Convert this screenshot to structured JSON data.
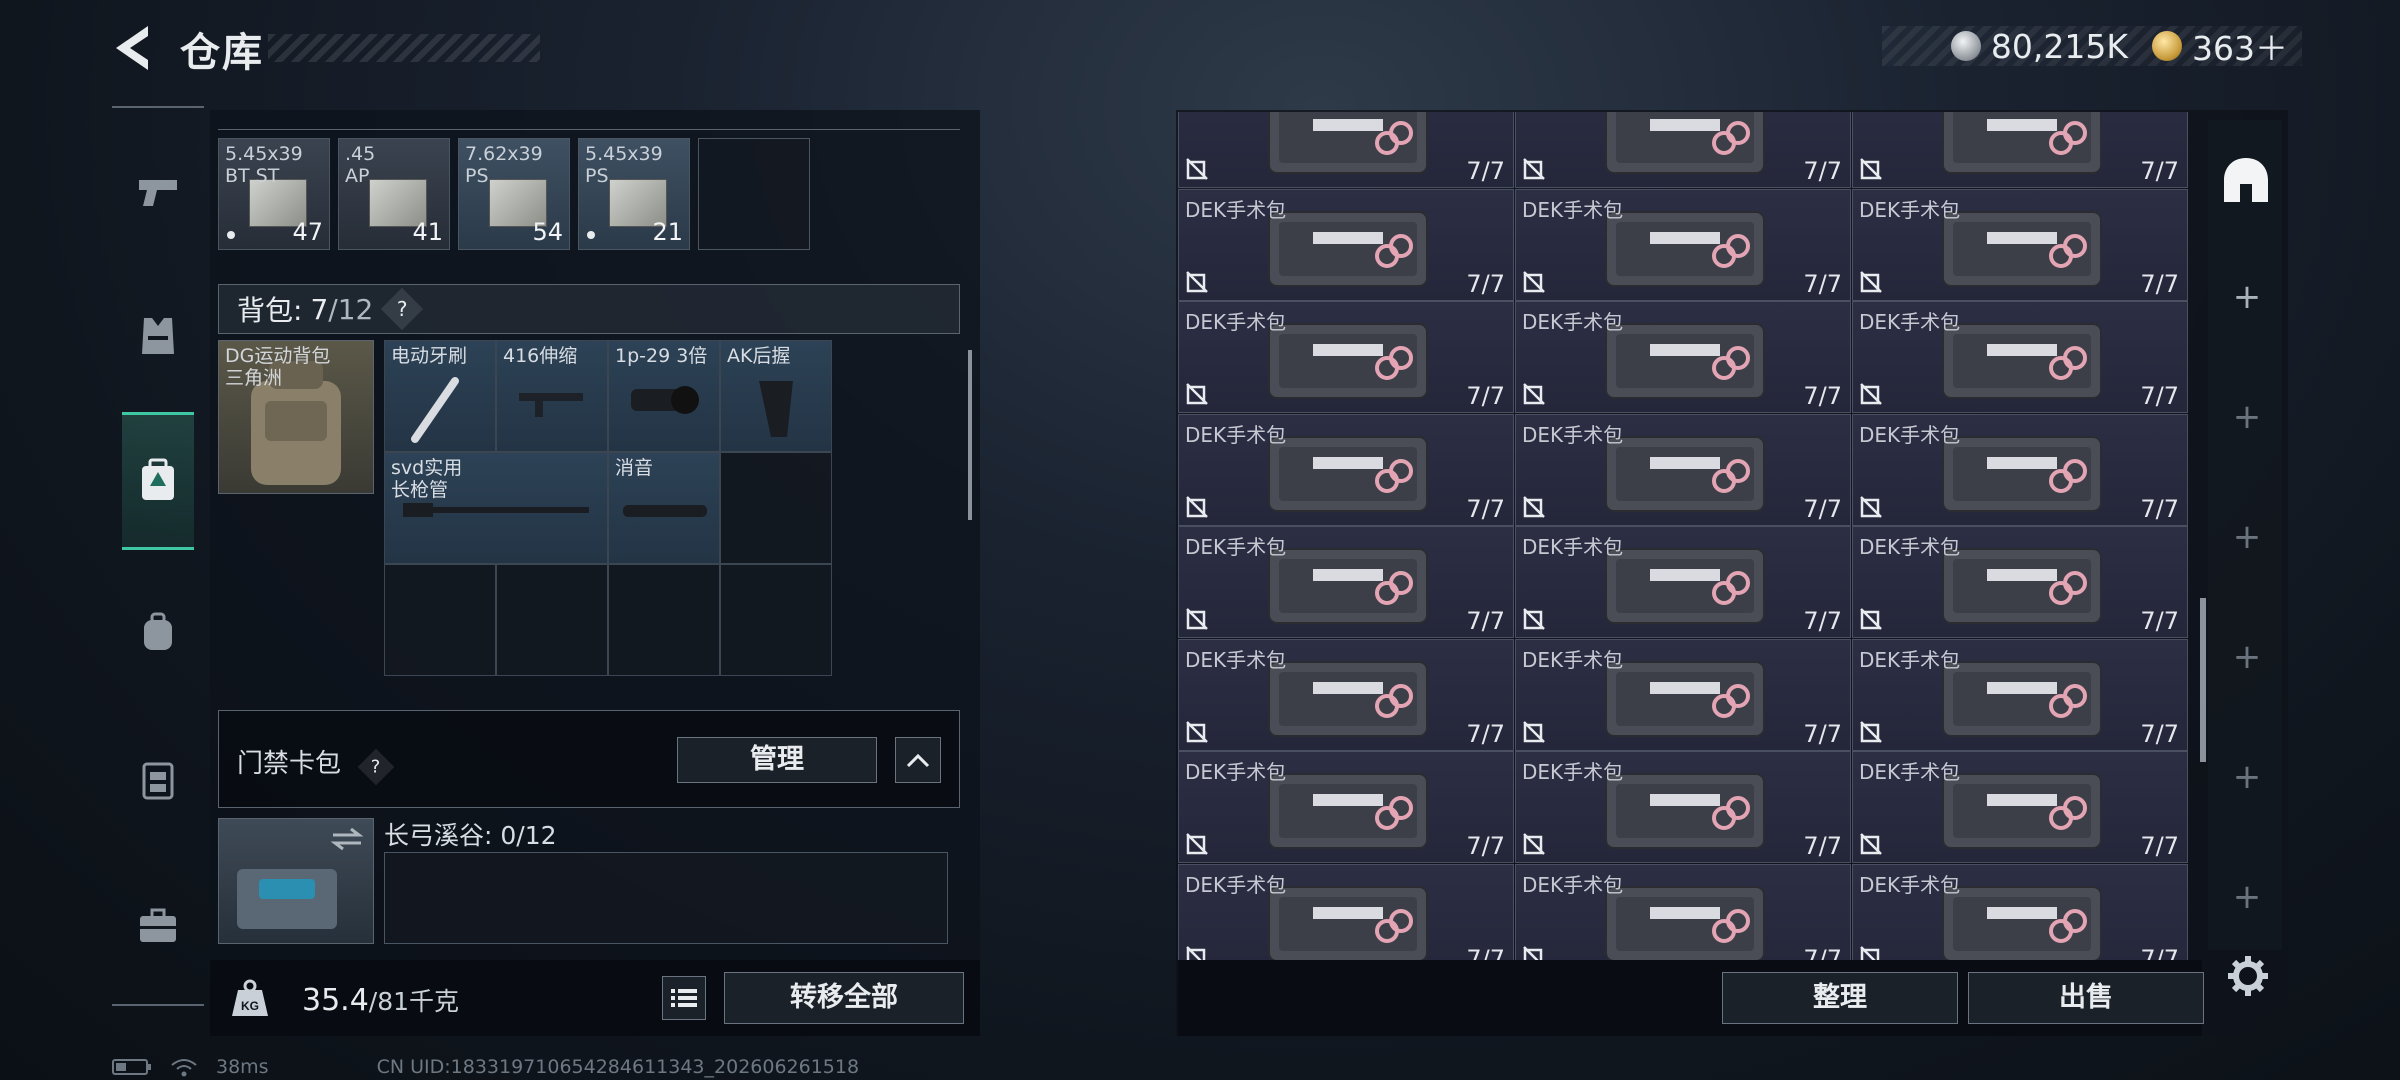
{
  "header": {
    "title": "仓库",
    "currency": [
      {
        "icon": "silver-coin-icon",
        "value": "80,215K"
      },
      {
        "icon": "gold-coin-icon",
        "value": "363＋"
      }
    ]
  },
  "nav": [
    {
      "name": "weapons",
      "icon": "pistol-icon"
    },
    {
      "name": "armor",
      "icon": "vest-icon"
    },
    {
      "name": "storage",
      "icon": "backpack-alert-icon",
      "active": true
    },
    {
      "name": "backpack",
      "icon": "backpack-icon"
    },
    {
      "name": "chest-rig",
      "icon": "rig-icon"
    },
    {
      "name": "case",
      "icon": "briefcase-icon"
    }
  ],
  "ammo": [
    {
      "name": "5.45x39\nBT ST",
      "count": "47",
      "dot": true
    },
    {
      "name": ".45\nAP",
      "count": "41",
      "dot": false
    },
    {
      "name": "7.62x39\nPS",
      "count": "54",
      "dot": false
    },
    {
      "name": "5.45x39\nPS",
      "count": "21",
      "dot": true
    },
    {
      "name": "",
      "count": "",
      "dot": false
    }
  ],
  "backpack": {
    "label": "背包:",
    "count": "7",
    "capacity": "/12",
    "help": "?",
    "bag_name": "DG运动背包\n三角洲",
    "items": [
      {
        "label": "电动牙刷"
      },
      {
        "label": "416伸缩"
      },
      {
        "label": "1p-29 3倍"
      },
      {
        "label": "AK后握"
      },
      {
        "label": "svd实用\n长枪管"
      },
      {
        "label": "消音"
      }
    ]
  },
  "keycard": {
    "label": "门禁卡包",
    "help": "?",
    "manage": "管理",
    "location": "长弓溪谷: 0/12"
  },
  "weight": {
    "current": "35.4",
    "max": "/81千克",
    "transfer": "转移全部"
  },
  "storage": {
    "item_name": "DEK手术包",
    "item_count": "7/7",
    "rows": 7,
    "cols": 3
  },
  "actions": {
    "sort": "整理",
    "sell": "出售"
  },
  "status": {
    "ping": "38ms",
    "uid": "CN UID:183319710654284611343_202606261518"
  },
  "colors": {
    "accent": "#3fc6a2",
    "item_bg": "#2c2e44"
  }
}
